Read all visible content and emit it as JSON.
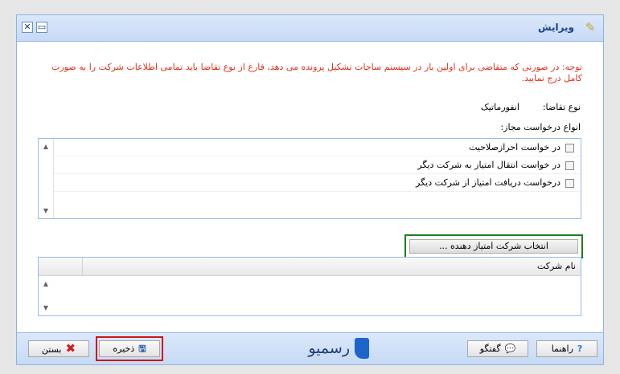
{
  "window": {
    "title": "ویرایش"
  },
  "notice": "توجه: در صورتی که متقاضی برای اولین بار در سیستم ساجات تشکیل پرونده می دهد، فارغ از نوع تقاضا باید تمامی اطلاعات شرکت را به صورت کامل درج نمایید.",
  "request_type": {
    "label": "نوع تقاضا:",
    "value": "انفورماتیک"
  },
  "allowed_requests": {
    "label": "انواع درخواست مجاز:",
    "items": [
      "در خواست احرازصلاحیت",
      "در خواست انتقال امتیاز به شرکت دیگر",
      "درخواست دریافت امتیاز از شرکت دیگر"
    ]
  },
  "select_company_button": "انتخاب شرکت امتیاز دهنده ...",
  "companies_grid": {
    "column": "نام شرکت",
    "rows": []
  },
  "footer": {
    "help": "راهنما",
    "chat": "گفتگو",
    "save": "ذخیره",
    "close": "بستن",
    "logo": "رسمیو"
  },
  "colors": {
    "notice": "#e0311c",
    "save_highlight": "#d01515",
    "select_highlight": "#1e7d1e"
  }
}
